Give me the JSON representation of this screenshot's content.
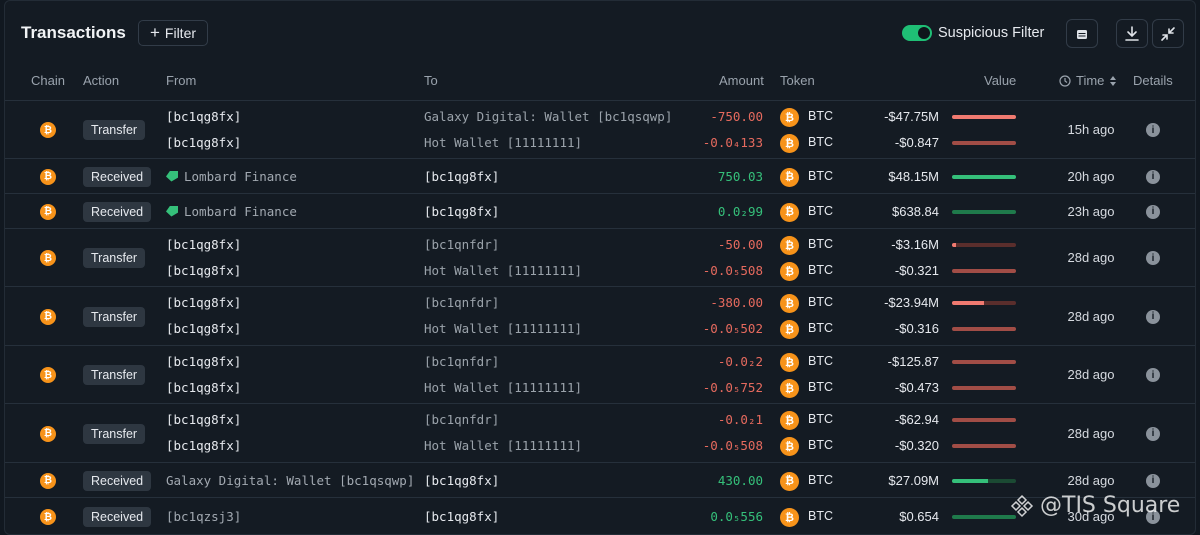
{
  "header": {
    "title": "Transactions",
    "filter_label": "Filter",
    "suspicious_label": "Suspicious Filter",
    "suspicious_on": true
  },
  "columns": {
    "chain": "Chain",
    "action": "Action",
    "from": "From",
    "to": "To",
    "amount": "Amount",
    "token": "Token",
    "value": "Value",
    "time": "Time",
    "details": "Details"
  },
  "colors": {
    "negative": "#e66a5e",
    "positive": "#35c07a",
    "btc": "#f7931a",
    "bar_neg": "#a14d46",
    "bar_neg_bright": "#f07a70",
    "bar_pos": "#35c07a",
    "bar_pos_dim": "#1f7a4b"
  },
  "icons": {
    "chain": "bitcoin-icon",
    "token": "bitcoin-icon",
    "details": "info-icon",
    "time": "clock-icon",
    "calendar": "calendar-icon",
    "download": "download-icon",
    "collapse": "collapse-icon"
  },
  "rows": [
    {
      "action": "Transfer",
      "lines": [
        {
          "from": "[bc1qg8fx]",
          "to": "Galaxy Digital: Wallet [bc1qsqwp]",
          "amount": "-750.00",
          "token": "BTC",
          "value": "-$47.75M",
          "level": 1.0
        },
        {
          "from": "[bc1qg8fx]",
          "to": "Hot Wallet [11111111]",
          "amount": "-0.0₄133",
          "token": "BTC",
          "value": "-$0.847",
          "level": 1.0
        }
      ],
      "time": "15h ago"
    },
    {
      "action": "Received",
      "lines": [
        {
          "from": "Lombard Finance",
          "to": "[bc1qg8fx]",
          "amount": "750.03",
          "token": "BTC",
          "value": "$48.15M",
          "level": 1.0
        }
      ],
      "time": "20h ago"
    },
    {
      "action": "Received",
      "lines": [
        {
          "from": "Lombard Finance",
          "to": "[bc1qg8fx]",
          "amount": "0.0₂99",
          "token": "BTC",
          "value": "$638.84",
          "level": 1.0
        }
      ],
      "time": "23h ago"
    },
    {
      "action": "Transfer",
      "lines": [
        {
          "from": "[bc1qg8fx]",
          "to": "[bc1qnfdr]",
          "amount": "-50.00",
          "token": "BTC",
          "value": "-$3.16M",
          "level": 0.07
        },
        {
          "from": "[bc1qg8fx]",
          "to": "Hot Wallet [11111111]",
          "amount": "-0.0₅508",
          "token": "BTC",
          "value": "-$0.321",
          "level": 1.0
        }
      ],
      "time": "28d ago"
    },
    {
      "action": "Transfer",
      "lines": [
        {
          "from": "[bc1qg8fx]",
          "to": "[bc1qnfdr]",
          "amount": "-380.00",
          "token": "BTC",
          "value": "-$23.94M",
          "level": 0.5
        },
        {
          "from": "[bc1qg8fx]",
          "to": "Hot Wallet [11111111]",
          "amount": "-0.0₅502",
          "token": "BTC",
          "value": "-$0.316",
          "level": 1.0
        }
      ],
      "time": "28d ago"
    },
    {
      "action": "Transfer",
      "lines": [
        {
          "from": "[bc1qg8fx]",
          "to": "[bc1qnfdr]",
          "amount": "-0.0₂2",
          "token": "BTC",
          "value": "-$125.87",
          "level": 1.0
        },
        {
          "from": "[bc1qg8fx]",
          "to": "Hot Wallet [11111111]",
          "amount": "-0.0₅752",
          "token": "BTC",
          "value": "-$0.473",
          "level": 1.0
        }
      ],
      "time": "28d ago"
    },
    {
      "action": "Transfer",
      "lines": [
        {
          "from": "[bc1qg8fx]",
          "to": "[bc1qnfdr]",
          "amount": "-0.0₂1",
          "token": "BTC",
          "value": "-$62.94",
          "level": 1.0
        },
        {
          "from": "[bc1qg8fx]",
          "to": "Hot Wallet [11111111]",
          "amount": "-0.0₅508",
          "token": "BTC",
          "value": "-$0.320",
          "level": 1.0
        }
      ],
      "time": "28d ago"
    },
    {
      "action": "Received",
      "lines": [
        {
          "from": "Galaxy Digital: Wallet [bc1qsqwp]",
          "to": "[bc1qg8fx]",
          "amount": "430.00",
          "token": "BTC",
          "value": "$27.09M",
          "level": 0.56
        }
      ],
      "time": "28d ago"
    },
    {
      "action": "Received",
      "lines": [
        {
          "from": "[bc1qzsj3]",
          "to": "[bc1qg8fx]",
          "amount": "0.0₅556",
          "token": "BTC",
          "value": "$0.654",
          "level": 1.0
        }
      ],
      "time": "30d ago"
    }
  ],
  "watermark": "@TIS Square"
}
